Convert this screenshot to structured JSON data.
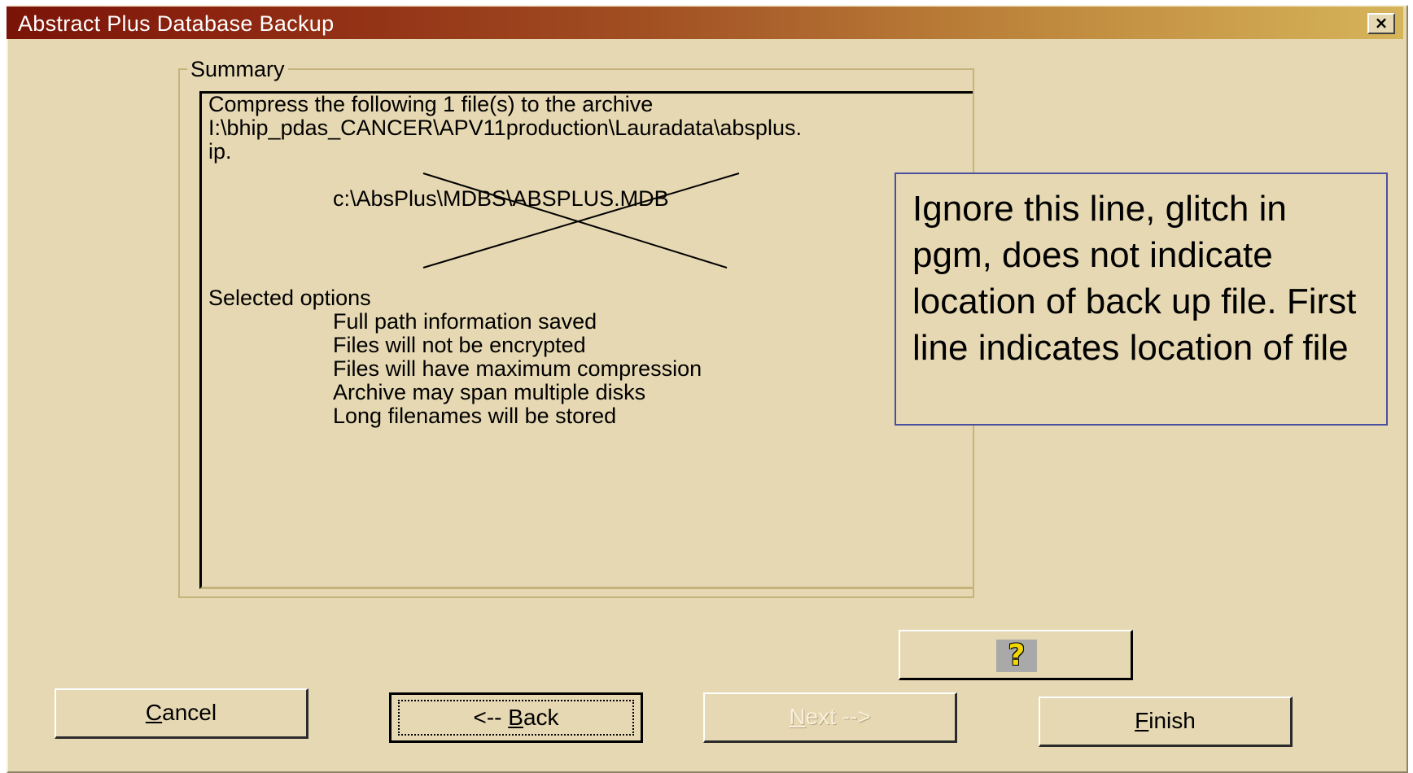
{
  "window": {
    "title": "Abstract Plus Database Backup",
    "close_symbol": "×"
  },
  "summary": {
    "group_label": "Summary",
    "compress_line": "Compress the following  1 file(s) to the archive",
    "archive_path": "I:\\bhip_pdas_CANCER\\APV11production\\Lauradata\\absplus.",
    "archive_path_cont": "ip.",
    "file_path": "c:\\AbsPlus\\MDBS\\ABSPLUS.MDB",
    "options_header": "Selected options",
    "options": [
      "Full path information saved",
      "Files will not be encrypted",
      "Files will have maximum compression",
      "Archive may span multiple disks",
      "Long filenames will be stored"
    ]
  },
  "callout": {
    "text": "Ignore this line, glitch in pgm, does not indicate location of back up file. First line indicates location of file"
  },
  "buttons": {
    "help_icon": "?",
    "cancel": {
      "mnemonic": "C",
      "rest": "ancel"
    },
    "back": {
      "prefix": "<-- ",
      "mnemonic": "B",
      "rest": "ack"
    },
    "next": {
      "mnemonic": "N",
      "rest": "ext -->"
    },
    "finish": {
      "mnemonic": "F",
      "rest": "inish"
    }
  },
  "icons": {
    "close": "close-icon",
    "help": "help-question-icon"
  },
  "colors": {
    "dialog_bg": "#e6d8b2",
    "title_start": "#7a1408",
    "title_end": "#d6b45a",
    "callout_border": "#4b4fa0"
  }
}
